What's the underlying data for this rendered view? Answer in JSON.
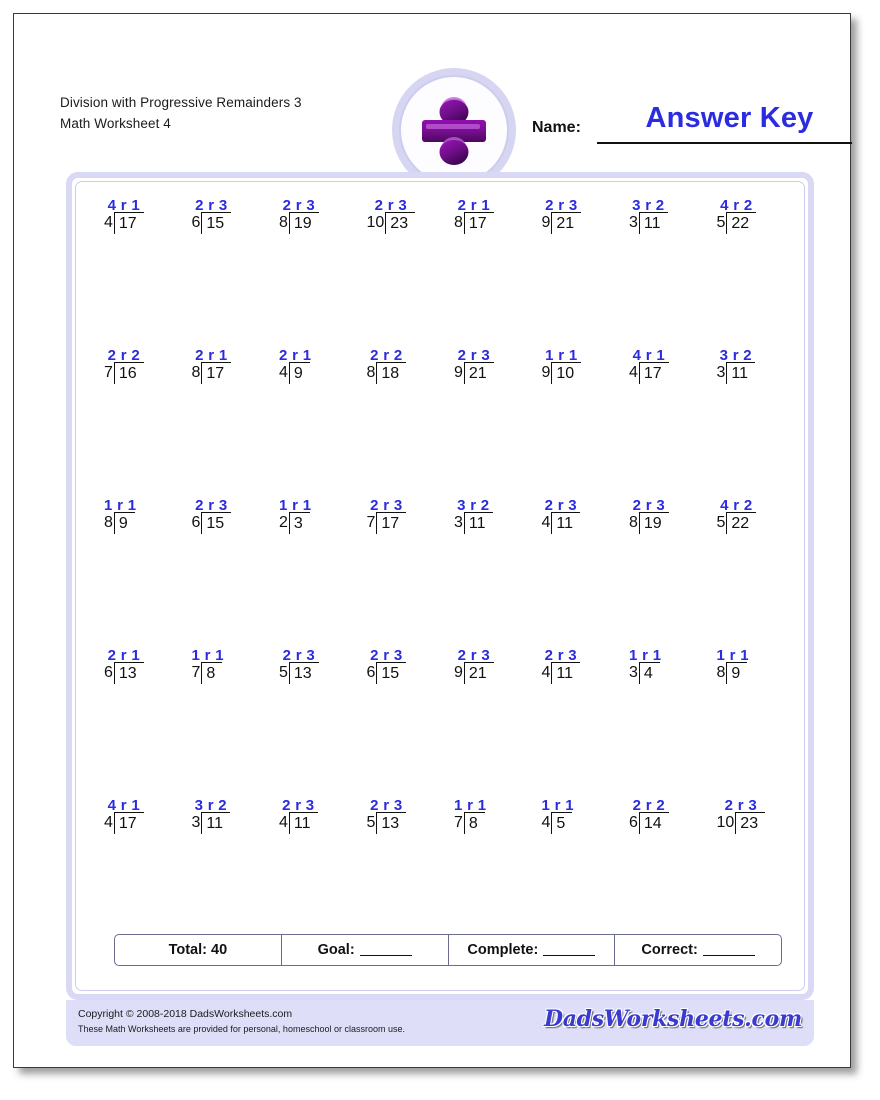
{
  "worksheet": {
    "title": "Division with Progressive Remainders 3",
    "subtitle": "Math Worksheet 4",
    "logo_icon": "divide-sign-icon",
    "name_label": "Name:",
    "name_value": "Answer Key",
    "accent_color": "#2b2be0",
    "logo_color": "#7a0f93",
    "panel_border_color": "#d9d9f6",
    "footer_bg_color": "#dedef8"
  },
  "problems": [
    [
      {
        "divisor": "4",
        "dividend": "17",
        "quotient": "4 r 1"
      },
      {
        "divisor": "6",
        "dividend": "15",
        "quotient": "2 r 3"
      },
      {
        "divisor": "8",
        "dividend": "19",
        "quotient": "2 r 3"
      },
      {
        "divisor": "10",
        "dividend": "23",
        "quotient": "2 r 3"
      },
      {
        "divisor": "8",
        "dividend": "17",
        "quotient": "2 r 1"
      },
      {
        "divisor": "9",
        "dividend": "21",
        "quotient": "2 r 3"
      },
      {
        "divisor": "3",
        "dividend": "11",
        "quotient": "3 r 2"
      },
      {
        "divisor": "5",
        "dividend": "22",
        "quotient": "4 r 2"
      }
    ],
    [
      {
        "divisor": "7",
        "dividend": "16",
        "quotient": "2 r 2"
      },
      {
        "divisor": "8",
        "dividend": "17",
        "quotient": "2 r 1"
      },
      {
        "divisor": "4",
        "dividend": "9",
        "quotient": "2 r 1"
      },
      {
        "divisor": "8",
        "dividend": "18",
        "quotient": "2 r 2"
      },
      {
        "divisor": "9",
        "dividend": "21",
        "quotient": "2 r 3"
      },
      {
        "divisor": "9",
        "dividend": "10",
        "quotient": "1 r 1"
      },
      {
        "divisor": "4",
        "dividend": "17",
        "quotient": "4 r 1"
      },
      {
        "divisor": "3",
        "dividend": "11",
        "quotient": "3 r 2"
      }
    ],
    [
      {
        "divisor": "8",
        "dividend": "9",
        "quotient": "1 r 1"
      },
      {
        "divisor": "6",
        "dividend": "15",
        "quotient": "2 r 3"
      },
      {
        "divisor": "2",
        "dividend": "3",
        "quotient": "1 r 1"
      },
      {
        "divisor": "7",
        "dividend": "17",
        "quotient": "2 r 3"
      },
      {
        "divisor": "3",
        "dividend": "11",
        "quotient": "3 r 2"
      },
      {
        "divisor": "4",
        "dividend": "11",
        "quotient": "2 r 3"
      },
      {
        "divisor": "8",
        "dividend": "19",
        "quotient": "2 r 3"
      },
      {
        "divisor": "5",
        "dividend": "22",
        "quotient": "4 r 2"
      }
    ],
    [
      {
        "divisor": "6",
        "dividend": "13",
        "quotient": "2 r 1"
      },
      {
        "divisor": "7",
        "dividend": "8",
        "quotient": "1 r 1"
      },
      {
        "divisor": "5",
        "dividend": "13",
        "quotient": "2 r 3"
      },
      {
        "divisor": "6",
        "dividend": "15",
        "quotient": "2 r 3"
      },
      {
        "divisor": "9",
        "dividend": "21",
        "quotient": "2 r 3"
      },
      {
        "divisor": "4",
        "dividend": "11",
        "quotient": "2 r 3"
      },
      {
        "divisor": "3",
        "dividend": "4",
        "quotient": "1 r 1"
      },
      {
        "divisor": "8",
        "dividend": "9",
        "quotient": "1 r 1"
      }
    ],
    [
      {
        "divisor": "4",
        "dividend": "17",
        "quotient": "4 r 1"
      },
      {
        "divisor": "3",
        "dividend": "11",
        "quotient": "3 r 2"
      },
      {
        "divisor": "4",
        "dividend": "11",
        "quotient": "2 r 3"
      },
      {
        "divisor": "5",
        "dividend": "13",
        "quotient": "2 r 3"
      },
      {
        "divisor": "7",
        "dividend": "8",
        "quotient": "1 r 1"
      },
      {
        "divisor": "4",
        "dividend": "5",
        "quotient": "1 r 1"
      },
      {
        "divisor": "6",
        "dividend": "14",
        "quotient": "2 r 2"
      },
      {
        "divisor": "10",
        "dividend": "23",
        "quotient": "2 r 3"
      }
    ]
  ],
  "scorebar": [
    {
      "label": "Total: 40",
      "blank": false
    },
    {
      "label": "Goal:",
      "blank": true
    },
    {
      "label": "Complete:",
      "blank": true
    },
    {
      "label": "Correct:",
      "blank": true
    }
  ],
  "footer": {
    "copyright": "Copyright © 2008-2018 DadsWorksheets.com",
    "usage": "These Math Worksheets are provided for personal, homeschool or classroom use.",
    "brand": "DadsWorksheets.com"
  }
}
